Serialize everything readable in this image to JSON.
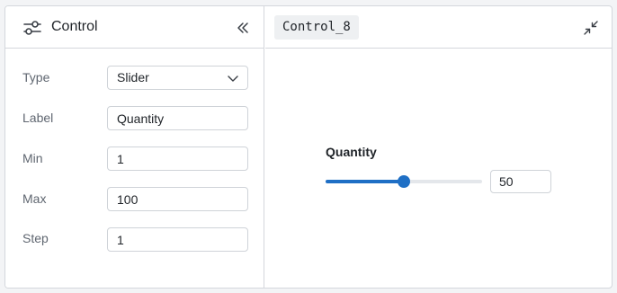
{
  "left_panel": {
    "title": "Control",
    "icons": {
      "header": "sliders-icon",
      "collapse": "double-chevron-left-icon"
    },
    "fields": [
      {
        "label": "Type",
        "value": "Slider",
        "kind": "select"
      },
      {
        "label": "Label",
        "value": "Quantity",
        "kind": "text"
      },
      {
        "label": "Min",
        "value": "1",
        "kind": "text"
      },
      {
        "label": "Max",
        "value": "100",
        "kind": "text"
      },
      {
        "label": "Step",
        "value": "1",
        "kind": "text"
      }
    ]
  },
  "right_panel": {
    "tab_label": "Control_8",
    "icons": {
      "minimize": "minimize-arrows-icon"
    },
    "widget": {
      "label": "Quantity",
      "value": "50",
      "min": 1,
      "max": 100,
      "fraction": 0.5
    }
  },
  "colors": {
    "accent": "#1f6fc5",
    "border": "#d4d7dc",
    "label_text": "#5f6670",
    "tab_bg": "#eef0f2"
  }
}
